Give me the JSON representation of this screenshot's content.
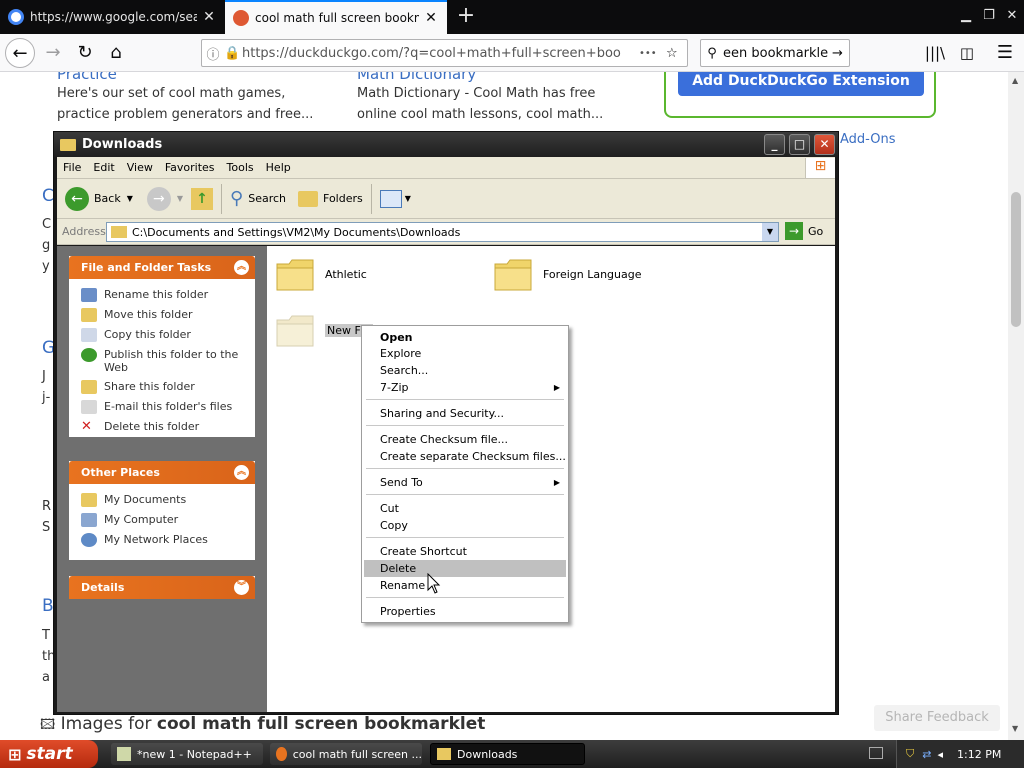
{
  "browser": {
    "tabs": [
      {
        "title": "https://www.google.com/search?",
        "active": false
      },
      {
        "title": "cool math full screen bookmarklet",
        "active": true
      }
    ],
    "url": "https://duckduckgo.com/?q=cool+math+full+screen+bookma",
    "search_value": "een bookmarklet",
    "page_actions": "•••"
  },
  "page": {
    "col1": {
      "heading": "Practice",
      "snippet1": "Here's our set of cool math games,",
      "snippet2": "practice problem generators and free..."
    },
    "col2": {
      "heading": "Math Dictionary",
      "snippet1": "Math Dictionary - Cool Math has free",
      "snippet2": "online cool math lessons, cool math..."
    },
    "extension_button": "Add DuckDuckGo Extension",
    "addons_link": "Add-Ons",
    "images_prefix": "Images for ",
    "images_query": "cool math full screen bookmarklet",
    "share_feedback": "Share Feedback",
    "left_letters": [
      "C",
      "C",
      "g",
      "y",
      "G",
      "J",
      "j-",
      "R",
      "S",
      "B",
      "T",
      "th",
      "a"
    ]
  },
  "explorer": {
    "title": "Downloads",
    "menu": [
      "File",
      "Edit",
      "View",
      "Favorites",
      "Tools",
      "Help"
    ],
    "toolbar": {
      "back": "Back",
      "search": "Search",
      "folders": "Folders"
    },
    "address_label": "Address",
    "address_value": "C:\\Documents and Settings\\VM2\\My Documents\\Downloads",
    "go_label": "Go",
    "tasks": {
      "heading": "File and Folder Tasks",
      "items": [
        "Rename this folder",
        "Move this folder",
        "Copy this folder",
        "Publish this folder to the Web",
        "Share this folder",
        "E-mail this folder's files",
        "Delete this folder"
      ]
    },
    "places": {
      "heading": "Other Places",
      "items": [
        "My Documents",
        "My Computer",
        "My Network Places"
      ]
    },
    "details_heading": "Details",
    "folders": [
      "Athletic",
      "Foreign Language",
      "New Folder"
    ]
  },
  "context_menu": {
    "items": [
      "Open",
      "Explore",
      "Search...",
      "7-Zip",
      "Sharing and Security...",
      "Create Checksum file...",
      "Create separate Checksum files...",
      "Send To",
      "Cut",
      "Copy",
      "Create Shortcut",
      "Delete",
      "Rename",
      "Properties"
    ],
    "highlighted": "Delete"
  },
  "taskbar": {
    "start": "start",
    "buttons": [
      "*new 1 - Notepad++",
      "cool math full screen ...",
      "Downloads"
    ],
    "clock": "1:12 PM"
  },
  "colors": {
    "firefox_dark": "#0c0c0d",
    "ddg_blue": "#3a6fdb",
    "xp_orange": "#e8731f",
    "start_red": "#c8381a"
  }
}
